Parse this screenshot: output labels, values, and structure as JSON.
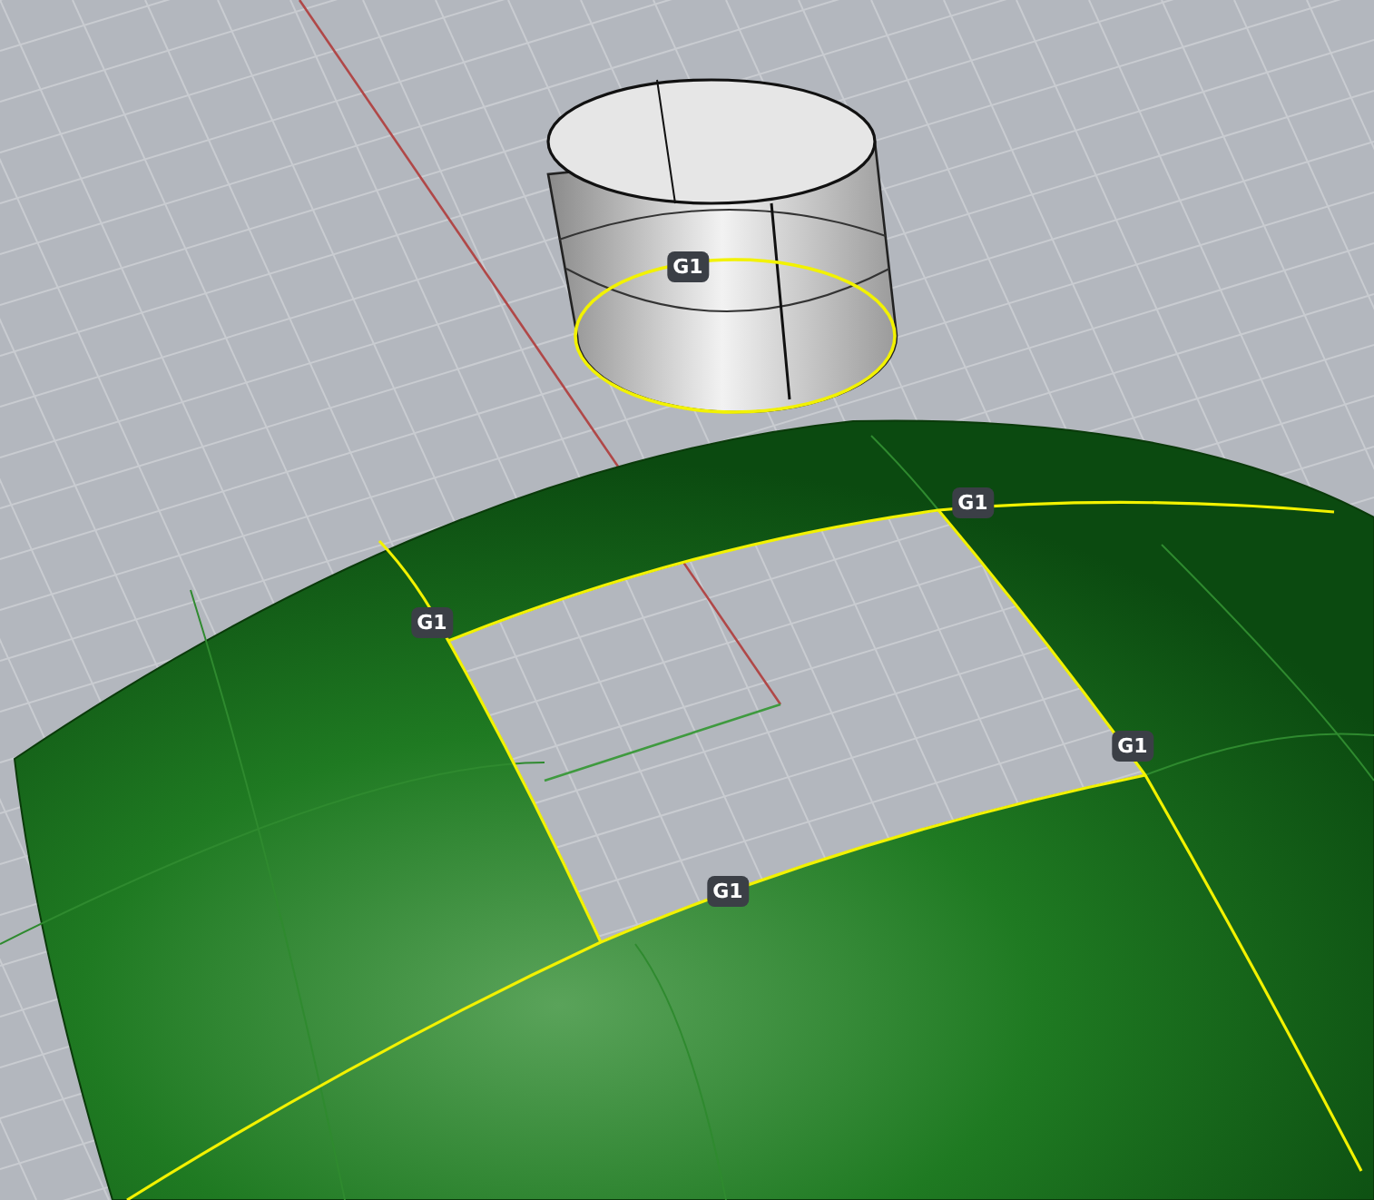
{
  "viewport": {
    "continuity_labels": [
      {
        "text": "G1"
      },
      {
        "text": "G1"
      },
      {
        "text": "G1"
      },
      {
        "text": "G1"
      },
      {
        "text": "G1"
      }
    ]
  }
}
